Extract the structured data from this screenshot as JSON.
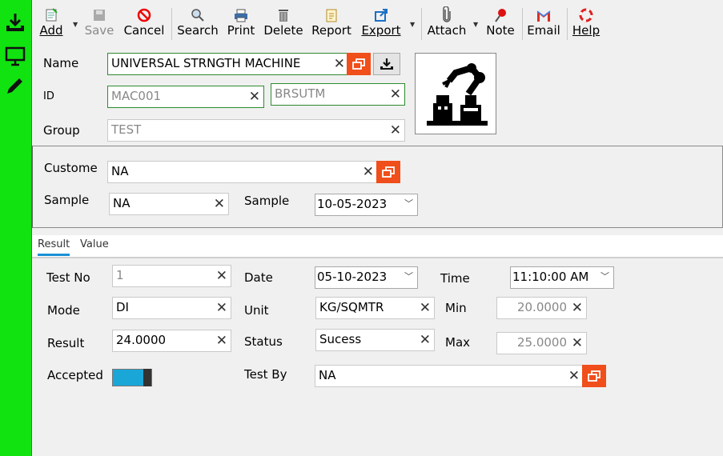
{
  "sidebar": {
    "icons": [
      "download-icon",
      "monitor-icon",
      "pencil-icon"
    ]
  },
  "toolbar": {
    "add": "Add",
    "save": "Save",
    "cancel": "Cancel",
    "search": "Search",
    "print": "Print",
    "delete": "Delete",
    "report": "Report",
    "export": "Export",
    "attach": "Attach",
    "note": "Note",
    "email": "Email",
    "help": "Help"
  },
  "header": {
    "name_label": "Name",
    "name_value": "UNIVERSAL STRNGTH MACHINE",
    "id_label": "ID",
    "id_value": "MAC001",
    "code_value": "BRSUTM",
    "group_label": "Group",
    "group_value": "TEST"
  },
  "customer": {
    "customer_label": "Custome",
    "customer_value": "NA",
    "sample_label": "Sample",
    "sample_value": "NA",
    "sample_date_label": "Sample",
    "sample_date_value": "10-05-2023"
  },
  "tabs": [
    {
      "label": "Result"
    },
    {
      "label": "Value"
    }
  ],
  "result": {
    "test_no_label": "Test No",
    "test_no_value": "1",
    "date_label": "Date",
    "date_value": "05-10-2023",
    "time_label": "Time",
    "time_value": "11:10:00 AM",
    "mode_label": "Mode",
    "mode_value": "DI",
    "unit_label": "Unit",
    "unit_value": "KG/SQMTR",
    "min_label": "Min",
    "min_value": "20.0000",
    "result_label": "Result",
    "result_value": "24.0000",
    "status_label": "Status",
    "status_value": "Sucess",
    "max_label": "Max",
    "max_value": "25.0000",
    "accepted_label": "Accepted",
    "accepted_on": true,
    "test_by_label": "Test By",
    "test_by_value": "NA"
  },
  "colors": {
    "sidebar": "#11e311",
    "accent_orange": "#f04e1a",
    "toggle": "#1aa7d8",
    "tab_underline": "#1a90d6"
  }
}
